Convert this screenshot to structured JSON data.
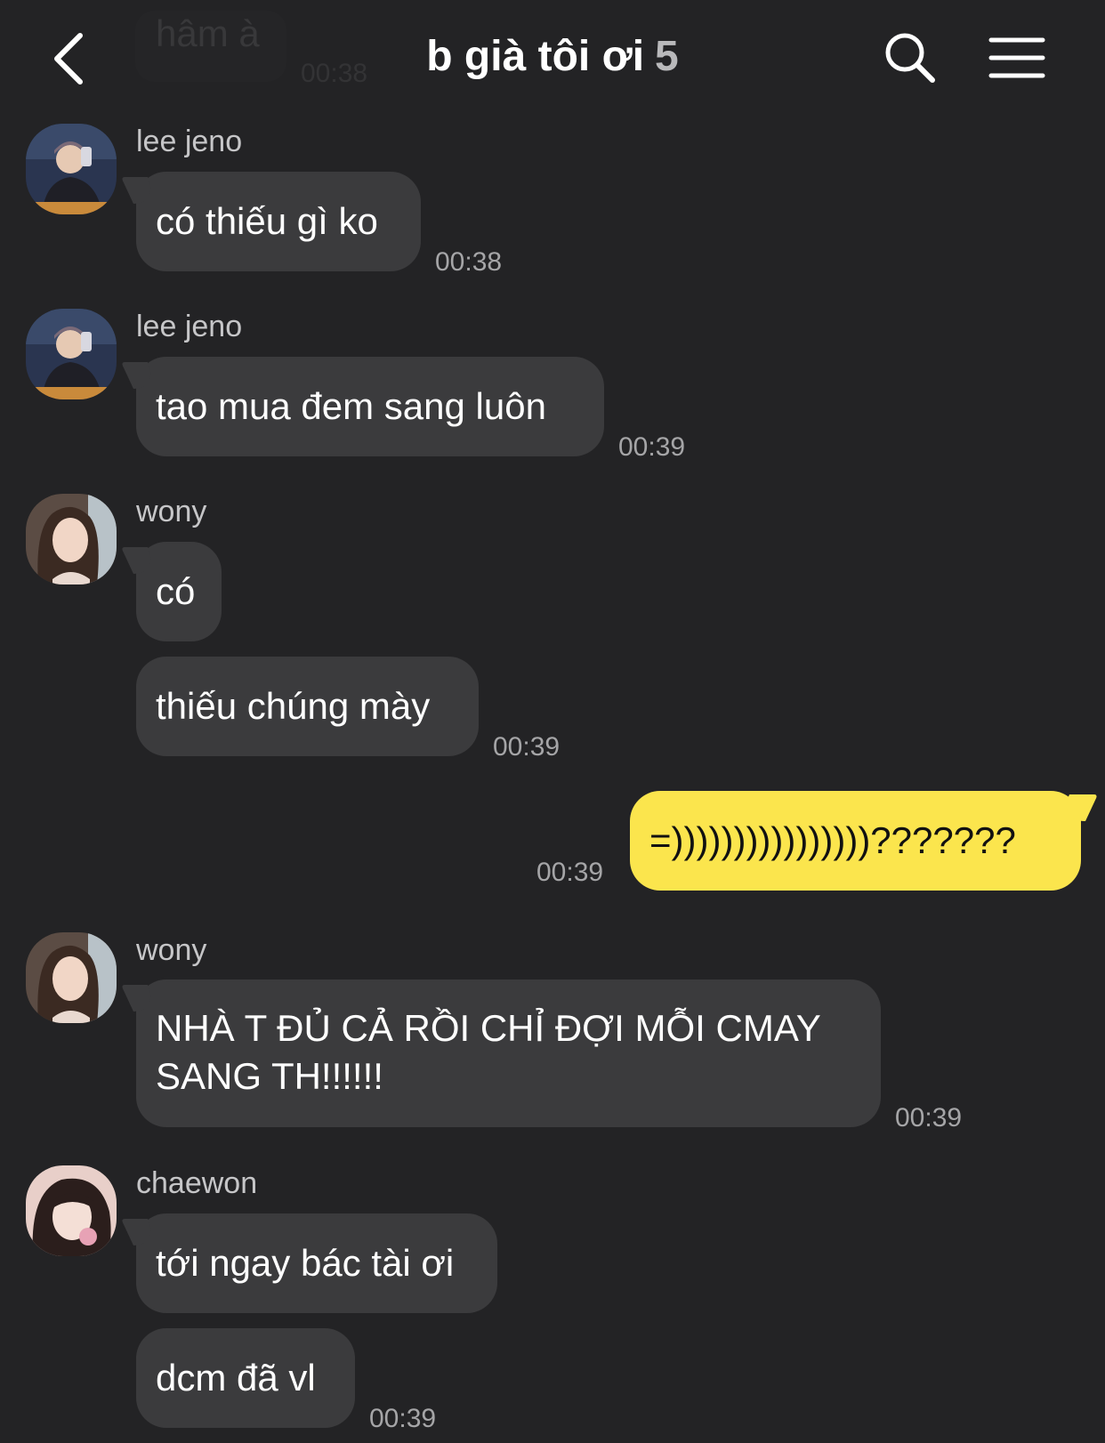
{
  "header": {
    "title": "b già tôi ơi",
    "member_count": "5",
    "back_icon": "chevron-left-icon",
    "search_icon": "search-icon",
    "menu_icon": "hamburger-menu-icon"
  },
  "ghost_message": {
    "text": "hâm à",
    "time": "00:38"
  },
  "messages": [
    {
      "sender": "lee jeno",
      "text": "có thiếu gì ko",
      "time": "00:38"
    },
    {
      "sender": "lee jeno",
      "text": "tao mua đem sang luôn",
      "time": "00:39"
    },
    {
      "sender": "wony",
      "text": "có"
    },
    {
      "text": "thiếu chúng mày",
      "time": "00:39"
    },
    {
      "mine": true,
      "text": "=))))))))))))))))???????",
      "time": "00:39"
    },
    {
      "sender": "wony",
      "text": "NHÀ T ĐỦ CẢ RỒI CHỈ ĐỢI MỖI CMAY SANG TH!!!!!!",
      "time": "00:39"
    },
    {
      "sender": "chaewon",
      "text": "tới ngay bác tài ơi"
    },
    {
      "text": "dcm đã vl",
      "time": "00:39"
    }
  ],
  "colors": {
    "background": "#232325",
    "bubble_other": "#3b3b3d",
    "bubble_mine": "#fbe54d",
    "time_text": "#a5a5a7"
  }
}
